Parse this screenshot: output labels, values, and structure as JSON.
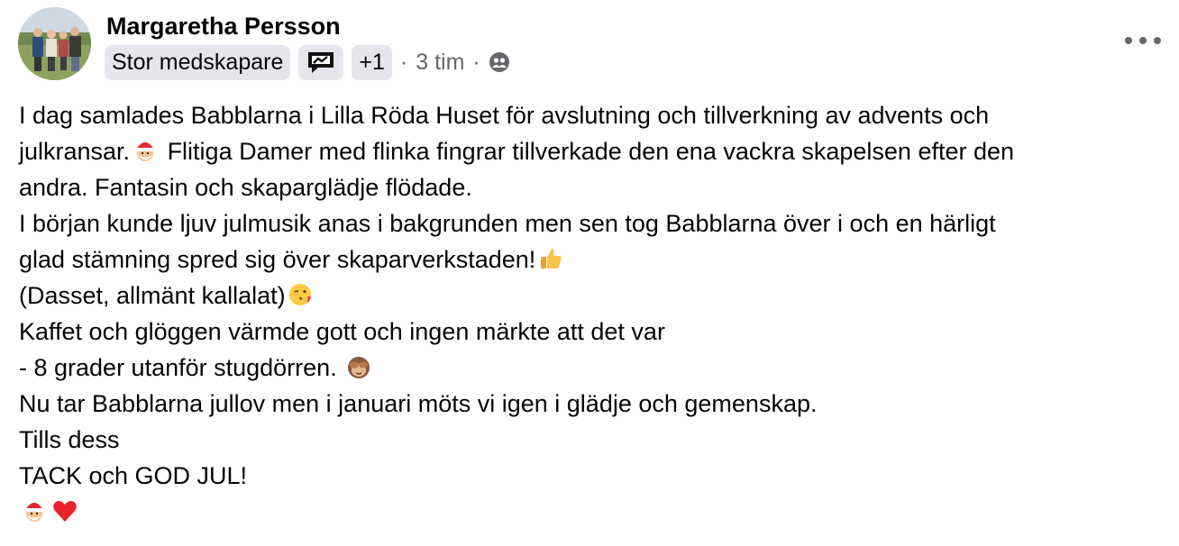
{
  "post": {
    "author": "Margaretha Persson",
    "badge": "Stor medskapare",
    "badge_icon": "speech-bubble-icon",
    "extra_badges": "+1",
    "separator": "·",
    "time": "3 tim",
    "audience_icon": "friends-icon",
    "more_icon": "more-options-icon",
    "lines": [
      {
        "text": "I dag samlades Babblarna i Lilla Röda Huset för avslutning och tillverkning av advents och",
        "emoji": null
      },
      {
        "text": "julkransar.",
        "emoji": "santa-icon",
        "after": " Flitiga Damer med flinka fingrar tillverkade den ena vackra skapelsen efter den"
      },
      {
        "text": "andra. Fantasin och skaparglädje flödade.",
        "emoji": null
      },
      {
        "text": "I början kunde ljuv julmusik anas i bakgrunden men sen tog Babblarna över i och en härligt",
        "emoji": null
      },
      {
        "text": "glad stämning spred sig över skaparverkstaden!",
        "emoji": "thumbs-up-icon"
      },
      {
        "text": "(Dasset, allmänt kallalat)",
        "emoji": "kiss-face-icon"
      },
      {
        "text": "Kaffet och glöggen värmde gott och ingen märkte att det var",
        "emoji": null
      },
      {
        "text": "- 8 grader utanför stugdörren. ",
        "emoji": "see-no-evil-monkey-icon"
      },
      {
        "text": "Nu tar Babblarna jullov men i januari möts vi igen i glädje och gemenskap.",
        "emoji": null
      },
      {
        "text": "Tills dess",
        "emoji": null
      },
      {
        "text": "TACK och GOD JUL!",
        "emoji": null
      },
      {
        "text": "",
        "emoji": "santa-icon",
        "emoji2": "red-heart-icon"
      }
    ]
  }
}
